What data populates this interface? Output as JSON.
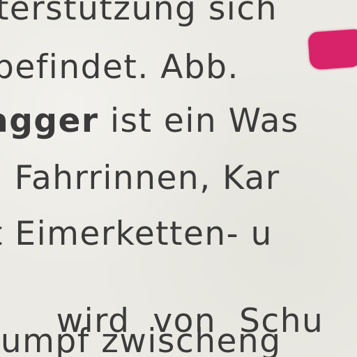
{
  "document": {
    "lines": [
      {
        "text": "terstützung   sich"
      },
      {
        "text": "befindet. Abb."
      },
      {
        "bold": "agger",
        "text": " ist ein Was"
      },
      {
        "text": "n Fahrrinnen, Kar"
      },
      {
        "text": "t Eimerketten- u"
      },
      {
        "text": "  wird  von  Schu"
      },
      {
        "text": "rumpf zwischeng"
      }
    ],
    "marker_color": "#d8236a"
  }
}
